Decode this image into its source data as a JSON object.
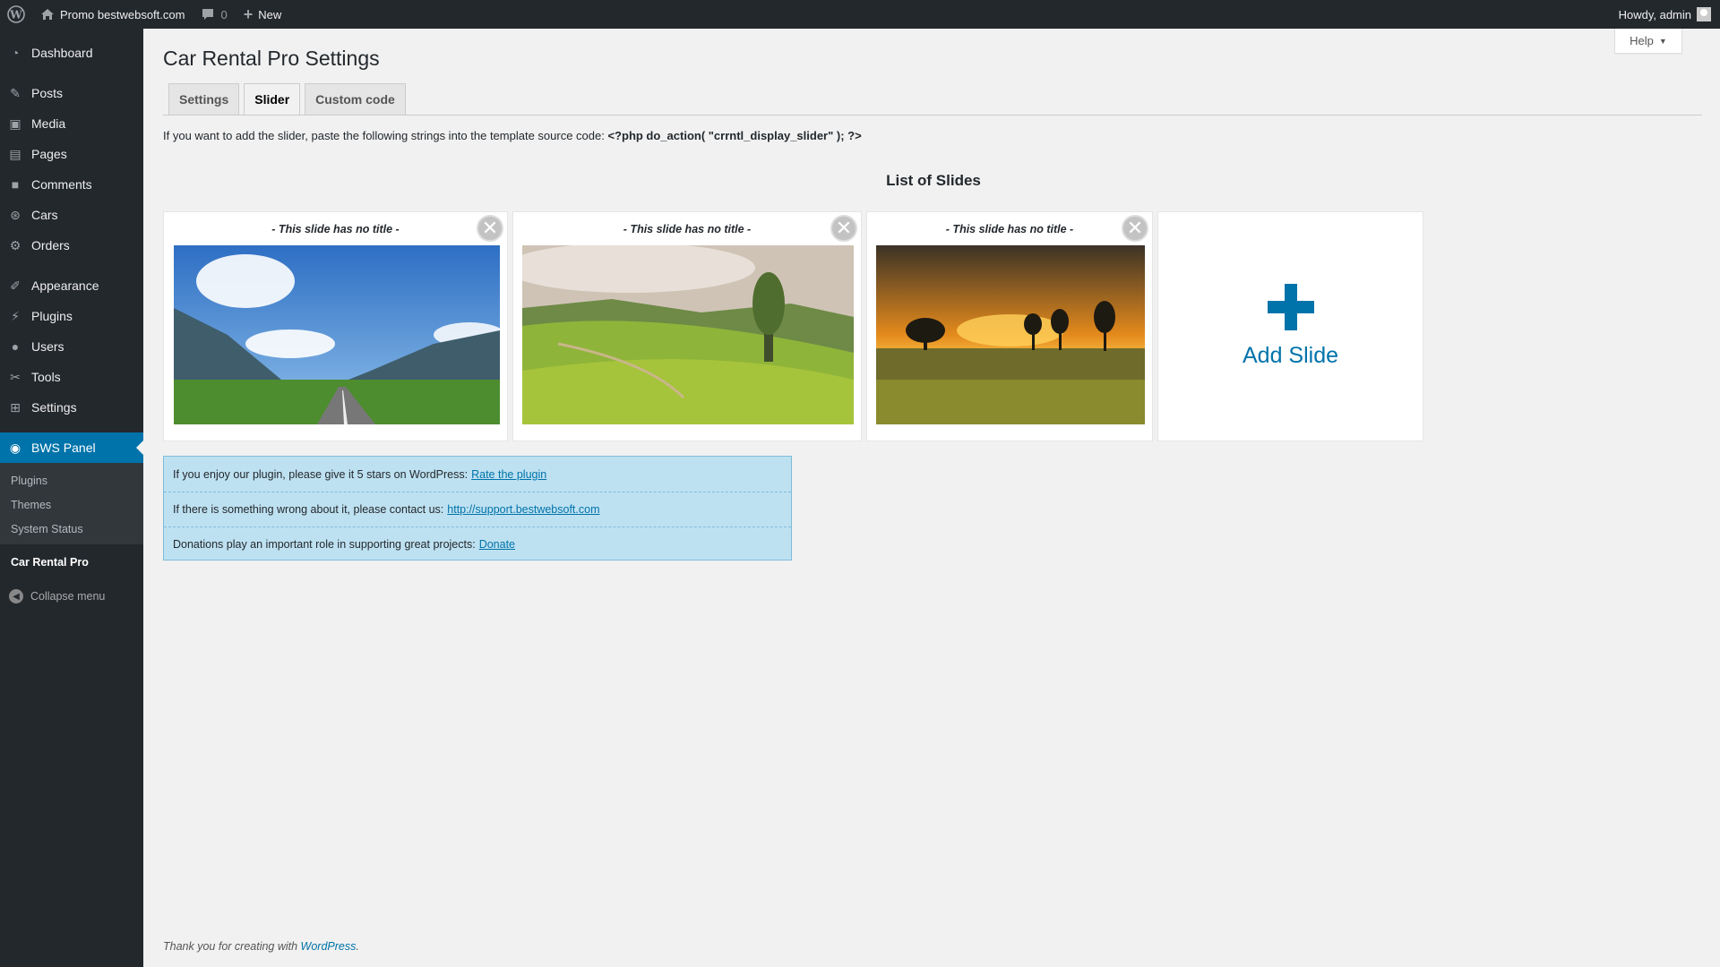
{
  "adminbar": {
    "site_name": "Promo bestwebsoft.com",
    "comments_count": "0",
    "new_label": "New",
    "howdy": "Howdy, admin"
  },
  "sidebar": {
    "items": [
      {
        "label": "Dashboard",
        "icon": "dashboard-icon"
      },
      {
        "label": "Posts",
        "icon": "pin-icon"
      },
      {
        "label": "Media",
        "icon": "media-icon"
      },
      {
        "label": "Pages",
        "icon": "pages-icon"
      },
      {
        "label": "Comments",
        "icon": "comment-icon"
      },
      {
        "label": "Cars",
        "icon": "wheel-icon"
      },
      {
        "label": "Orders",
        "icon": "gear-icon"
      },
      {
        "label": "Appearance",
        "icon": "brush-icon"
      },
      {
        "label": "Plugins",
        "icon": "plug-icon"
      },
      {
        "label": "Users",
        "icon": "user-icon"
      },
      {
        "label": "Tools",
        "icon": "wrench-icon"
      },
      {
        "label": "Settings",
        "icon": "sliders-icon"
      },
      {
        "label": "BWS Panel",
        "icon": "bws-icon"
      }
    ],
    "sub_items": [
      "Plugins",
      "Themes",
      "System Status"
    ],
    "current_item": "Car Rental Pro",
    "collapse_label": "Collapse menu"
  },
  "page": {
    "help_label": "Help",
    "title": "Car Rental Pro Settings",
    "tabs": [
      "Settings",
      "Slider",
      "Custom code"
    ],
    "active_tab": "Slider",
    "hint_text": "If you want to add the slider, paste the following strings into the template source code: ",
    "hint_code": "<?php do_action( \"crrntl_display_slider\" ); ?>",
    "list_title": "List of Slides"
  },
  "slides": [
    {
      "title": "- This slide has no title -",
      "image": "mountain-road"
    },
    {
      "title": "- This slide has no title -",
      "image": "green-hills"
    },
    {
      "title": "- This slide has no title -",
      "image": "sunset-field"
    }
  ],
  "add_slide_label": "Add Slide",
  "notice": {
    "rate_text": "If you enjoy our plugin, please give it 5 stars on WordPress:",
    "rate_link": "Rate the plugin",
    "support_text": "If there is something wrong about it, please contact us:",
    "support_link": "http://support.bestwebsoft.com",
    "donate_text": "Donations play an important role in supporting great projects:",
    "donate_link": "Donate"
  },
  "footer": {
    "text": "Thank you for creating with ",
    "link": "WordPress",
    "end": "."
  }
}
